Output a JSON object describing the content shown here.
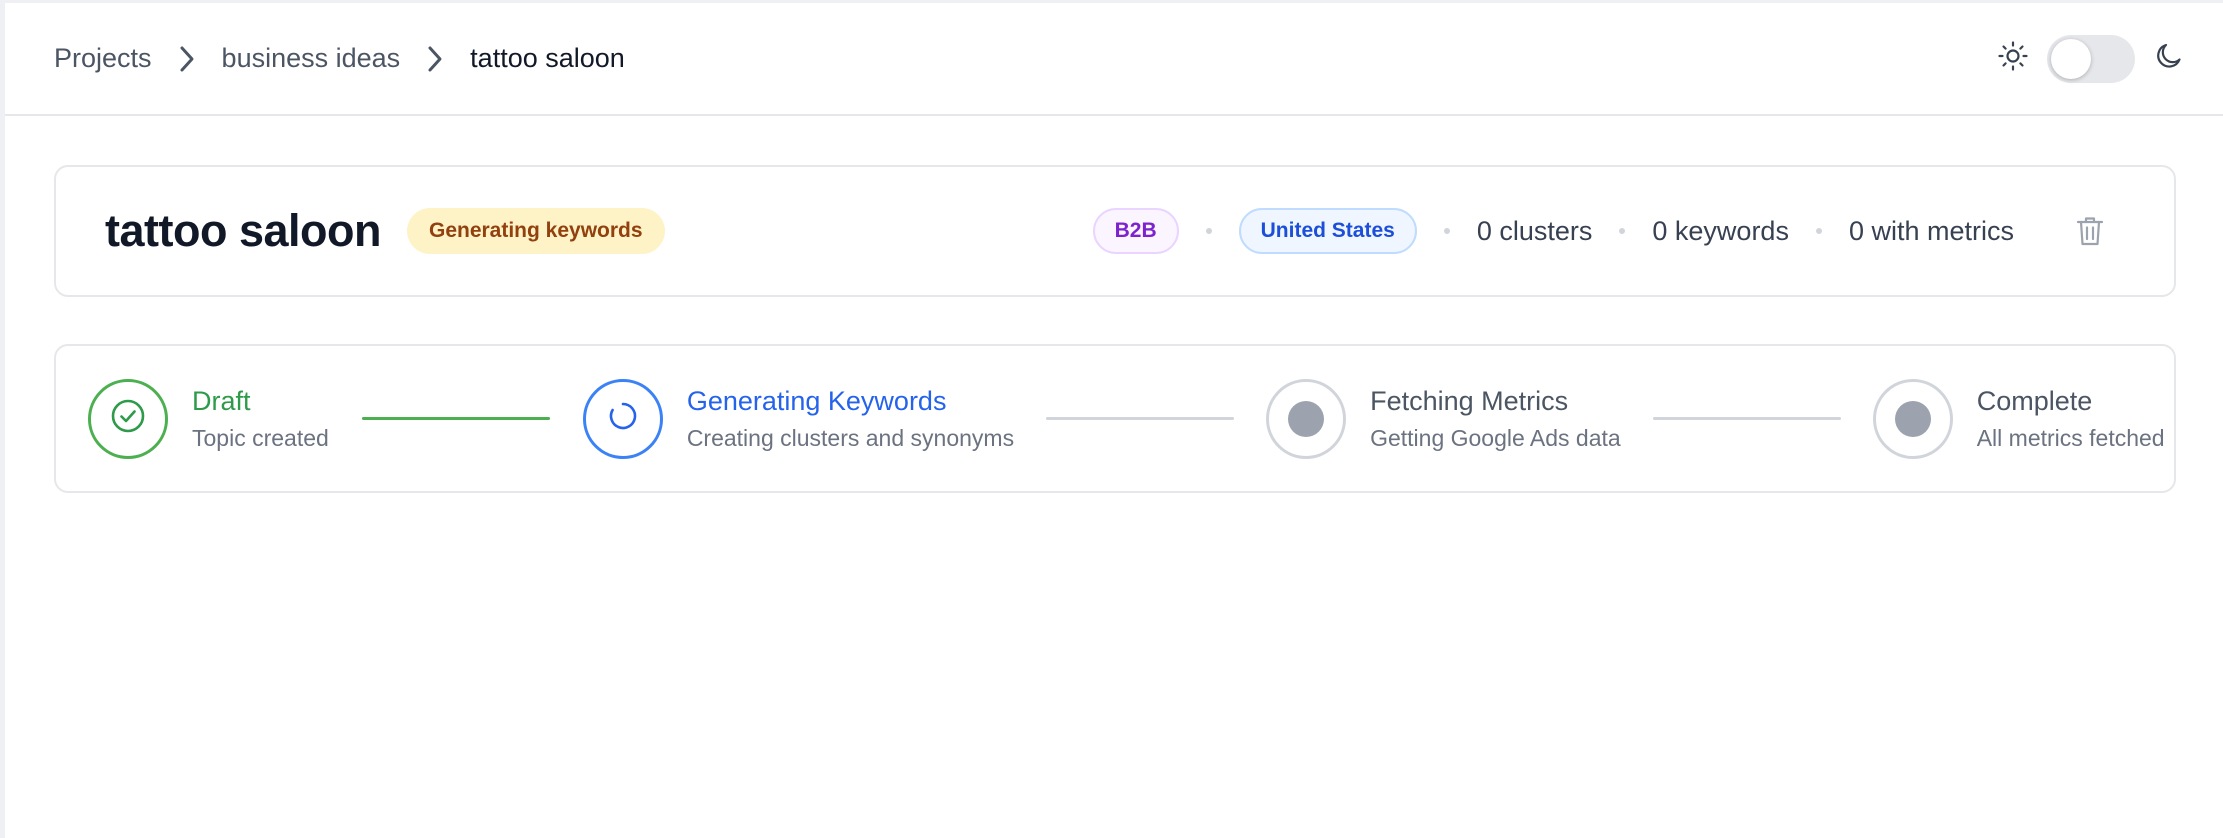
{
  "breadcrumb": {
    "items": [
      "Projects",
      "business ideas",
      "tattoo saloon"
    ]
  },
  "theme": {
    "light_icon": "sun-icon",
    "dark_icon": "moon-icon",
    "toggle_state": "light"
  },
  "topic": {
    "title": "tattoo saloon",
    "status": "Generating keywords",
    "type_tag": "B2B",
    "country_tag": "United States",
    "clusters": "0 clusters",
    "keywords": "0 keywords",
    "with_metrics": "0 with metrics",
    "delete_icon": "trash-icon"
  },
  "steps": [
    {
      "title": "Draft",
      "subtitle": "Topic created",
      "state": "done"
    },
    {
      "title": "Generating Keywords",
      "subtitle": "Creating clusters and synonyms",
      "state": "active"
    },
    {
      "title": "Fetching Metrics",
      "subtitle": "Getting Google Ads data",
      "state": "pending"
    },
    {
      "title": "Complete",
      "subtitle": "All metrics fetched",
      "state": "pending"
    }
  ],
  "colors": {
    "done": "#4caf50",
    "active": "#3b82f6",
    "pending": "#9ca3af",
    "status_bg": "#fef3c7",
    "status_text": "#92400e"
  }
}
